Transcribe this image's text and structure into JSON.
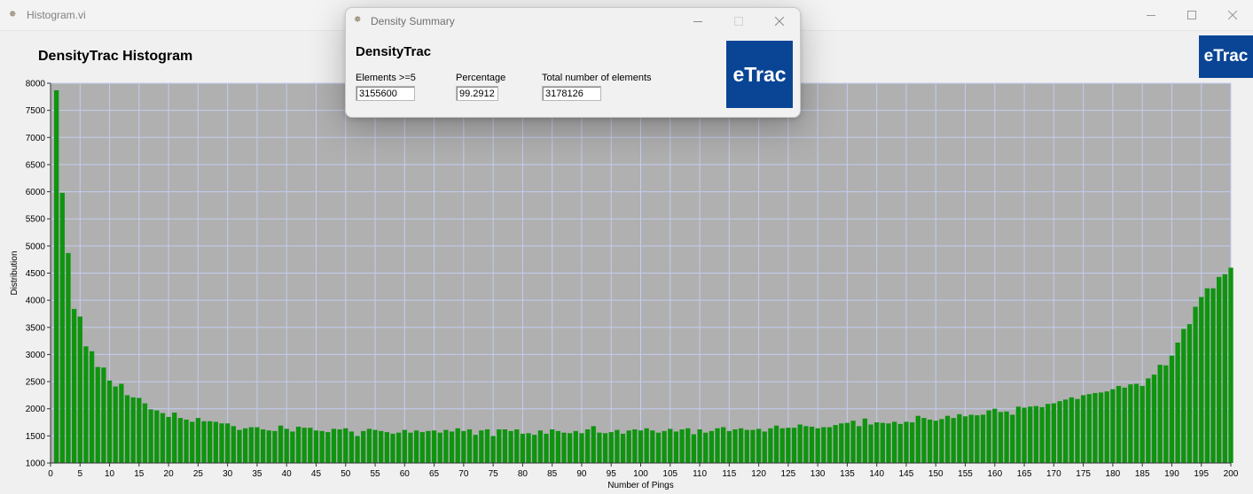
{
  "main_window": {
    "icon": "labview-vi-icon",
    "title": "Histogram.vi",
    "heading": "DensityTrac Histogram",
    "logo_text": "eTrac"
  },
  "dialog": {
    "icon": "labview-vi-icon",
    "title": "Density Summary",
    "heading": "DensityTrac",
    "logo_text": "eTrac",
    "fields": [
      {
        "label": "Elements >=5",
        "value": "3155600"
      },
      {
        "label": "Percentage",
        "value": "99.2912"
      },
      {
        "label": "Total number of elements",
        "value": "3178126"
      }
    ]
  },
  "colors": {
    "plot_background": "#b0b0b0",
    "grid": "#c3cdf0",
    "bar": "#0f9410",
    "logo": "#0a4595"
  },
  "chart_data": {
    "type": "bar",
    "xlabel": "Number of Pings",
    "ylabel": "Distribution",
    "xlim": [
      0,
      200
    ],
    "ylim": [
      1000,
      8000
    ],
    "x_ticks": [
      0,
      5,
      10,
      15,
      20,
      25,
      30,
      35,
      40,
      45,
      50,
      55,
      60,
      65,
      70,
      75,
      80,
      85,
      90,
      95,
      100,
      105,
      110,
      115,
      120,
      125,
      130,
      135,
      140,
      145,
      150,
      155,
      160,
      165,
      170,
      175,
      180,
      185,
      190,
      195,
      200
    ],
    "y_ticks": [
      1000,
      1500,
      2000,
      2500,
      3000,
      3500,
      4000,
      4500,
      5000,
      5500,
      6000,
      6500,
      7000,
      7500,
      8000
    ],
    "grid": true,
    "x": [
      1,
      2,
      3,
      4,
      5,
      6,
      7,
      8,
      9,
      10,
      11,
      12,
      13,
      14,
      15,
      16,
      17,
      18,
      19,
      20,
      21,
      22,
      23,
      24,
      25,
      26,
      27,
      28,
      29,
      30,
      31,
      32,
      33,
      34,
      35,
      36,
      37,
      38,
      39,
      40,
      41,
      42,
      43,
      44,
      45,
      46,
      47,
      48,
      49,
      50,
      51,
      52,
      53,
      54,
      55,
      56,
      57,
      58,
      59,
      60,
      61,
      62,
      63,
      64,
      65,
      66,
      67,
      68,
      69,
      70,
      71,
      72,
      73,
      74,
      75,
      76,
      77,
      78,
      79,
      80,
      81,
      82,
      83,
      84,
      85,
      86,
      87,
      88,
      89,
      90,
      91,
      92,
      93,
      94,
      95,
      96,
      97,
      98,
      99,
      100,
      101,
      102,
      103,
      104,
      105,
      106,
      107,
      108,
      109,
      110,
      111,
      112,
      113,
      114,
      115,
      116,
      117,
      118,
      119,
      120,
      121,
      122,
      123,
      124,
      125,
      126,
      127,
      128,
      129,
      130,
      131,
      132,
      133,
      134,
      135,
      136,
      137,
      138,
      139,
      140,
      141,
      142,
      143,
      144,
      145,
      146,
      147,
      148,
      149,
      150,
      151,
      152,
      153,
      154,
      155,
      156,
      157,
      158,
      159,
      160,
      161,
      162,
      163,
      164,
      165,
      166,
      167,
      168,
      169,
      170,
      171,
      172,
      173,
      174,
      175,
      176,
      177,
      178,
      179,
      180,
      181,
      182,
      183,
      184,
      185,
      186,
      187,
      188,
      189,
      190,
      191,
      192,
      193,
      194,
      195,
      196,
      197,
      198,
      199,
      200
    ],
    "values": [
      7870,
      5980,
      4870,
      3840,
      3700,
      3150,
      3060,
      2770,
      2760,
      2520,
      2410,
      2460,
      2250,
      2210,
      2200,
      2100,
      1990,
      1970,
      1920,
      1850,
      1930,
      1830,
      1800,
      1760,
      1830,
      1770,
      1770,
      1760,
      1730,
      1730,
      1680,
      1610,
      1640,
      1660,
      1660,
      1620,
      1600,
      1590,
      1690,
      1630,
      1580,
      1670,
      1650,
      1650,
      1600,
      1590,
      1570,
      1630,
      1620,
      1640,
      1580,
      1500,
      1590,
      1630,
      1610,
      1590,
      1570,
      1540,
      1560,
      1610,
      1560,
      1600,
      1570,
      1590,
      1600,
      1560,
      1610,
      1580,
      1640,
      1590,
      1620,
      1520,
      1600,
      1620,
      1500,
      1620,
      1620,
      1590,
      1620,
      1540,
      1550,
      1520,
      1600,
      1540,
      1620,
      1590,
      1560,
      1550,
      1590,
      1550,
      1620,
      1680,
      1560,
      1550,
      1570,
      1610,
      1540,
      1600,
      1620,
      1600,
      1640,
      1600,
      1560,
      1590,
      1630,
      1580,
      1620,
      1640,
      1530,
      1620,
      1560,
      1590,
      1640,
      1660,
      1590,
      1620,
      1640,
      1610,
      1610,
      1630,
      1580,
      1640,
      1690,
      1640,
      1650,
      1650,
      1710,
      1680,
      1670,
      1640,
      1660,
      1660,
      1700,
      1730,
      1740,
      1780,
      1680,
      1820,
      1710,
      1750,
      1740,
      1730,
      1760,
      1720,
      1760,
      1750,
      1870,
      1830,
      1800,
      1780,
      1810,
      1870,
      1830,
      1900,
      1860,
      1890,
      1880,
      1890,
      1970,
      2000,
      1940,
      1950,
      1890,
      2040,
      2020,
      2040,
      2050,
      2030,
      2090,
      2100,
      2140,
      2170,
      2210,
      2180,
      2250,
      2270,
      2290,
      2300,
      2320,
      2360,
      2420,
      2390,
      2450,
      2460,
      2420,
      2560,
      2630,
      2810,
      2800,
      2980,
      3220,
      3470,
      3560,
      3880,
      4060,
      4220,
      4220,
      4430,
      4480,
      4600
    ]
  }
}
